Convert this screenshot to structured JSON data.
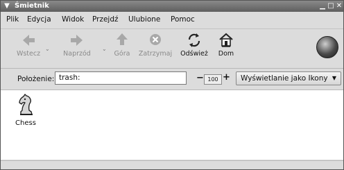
{
  "window": {
    "title": "Śmietnik"
  },
  "menubar": {
    "items": [
      "Plik",
      "Edycja",
      "Widok",
      "Przejdź",
      "Ulubione",
      "Pomoc"
    ]
  },
  "toolbar": {
    "back": "Wstecz",
    "forward": "Naprzód",
    "up": "Góra",
    "stop": "Zatrzymaj",
    "reload": "Odśwież",
    "home": "Dom"
  },
  "location": {
    "label": "Położenie:",
    "value": "trash:",
    "zoom": "100",
    "view_mode": "Wyświetlanie jako Ikony"
  },
  "content": {
    "items": [
      {
        "name": "Chess",
        "icon": "chess-knight-icon"
      }
    ]
  }
}
